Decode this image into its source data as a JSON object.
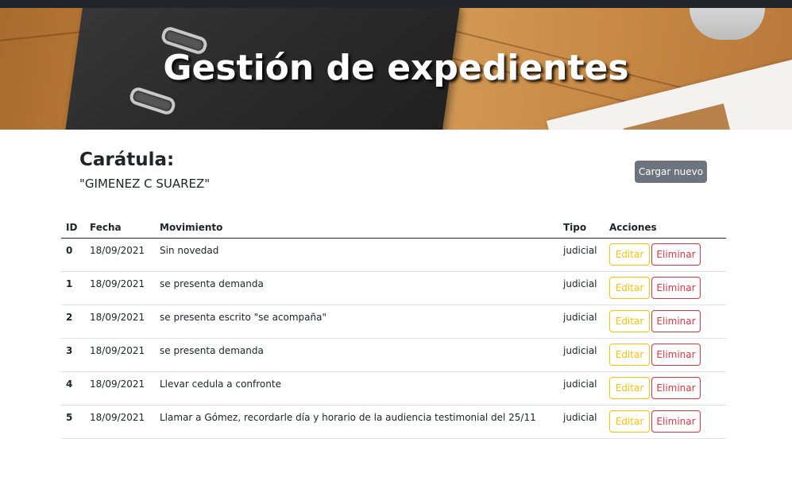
{
  "header": {
    "title": "Gestión de expedientes"
  },
  "caratula": {
    "label": "Carátula:",
    "value": "\"GIMENEZ C SUAREZ\""
  },
  "actions": {
    "cargar_label": "Cargar nuevo"
  },
  "table": {
    "columns": [
      "ID",
      "Fecha",
      "Movimiento",
      "Tipo",
      "Acciones"
    ],
    "edit_label": "Editar",
    "delete_label": "Eliminar",
    "rows": [
      {
        "id": "0",
        "fecha": "18/09/2021",
        "movimiento": "Sin novedad",
        "tipo": "judicial"
      },
      {
        "id": "1",
        "fecha": "18/09/2021",
        "movimiento": "se presenta demanda",
        "tipo": "judicial"
      },
      {
        "id": "2",
        "fecha": "18/09/2021",
        "movimiento": "se presenta escrito \"se acompaña\"",
        "tipo": "judicial"
      },
      {
        "id": "3",
        "fecha": "18/09/2021",
        "movimiento": "se presenta demanda",
        "tipo": "judicial"
      },
      {
        "id": "4",
        "fecha": "18/09/2021",
        "movimiento": "Llevar cedula a confronte",
        "tipo": "judicial"
      },
      {
        "id": "5",
        "fecha": "18/09/2021",
        "movimiento": "Llamar a Gómez, recordarle día y horario de la audiencia testimonial del 25/11",
        "tipo": "judicial"
      }
    ]
  },
  "colors": {
    "topbar": "#212529",
    "secondary": "#6c757d",
    "warning": "#ffc107",
    "danger": "#dc3545"
  }
}
